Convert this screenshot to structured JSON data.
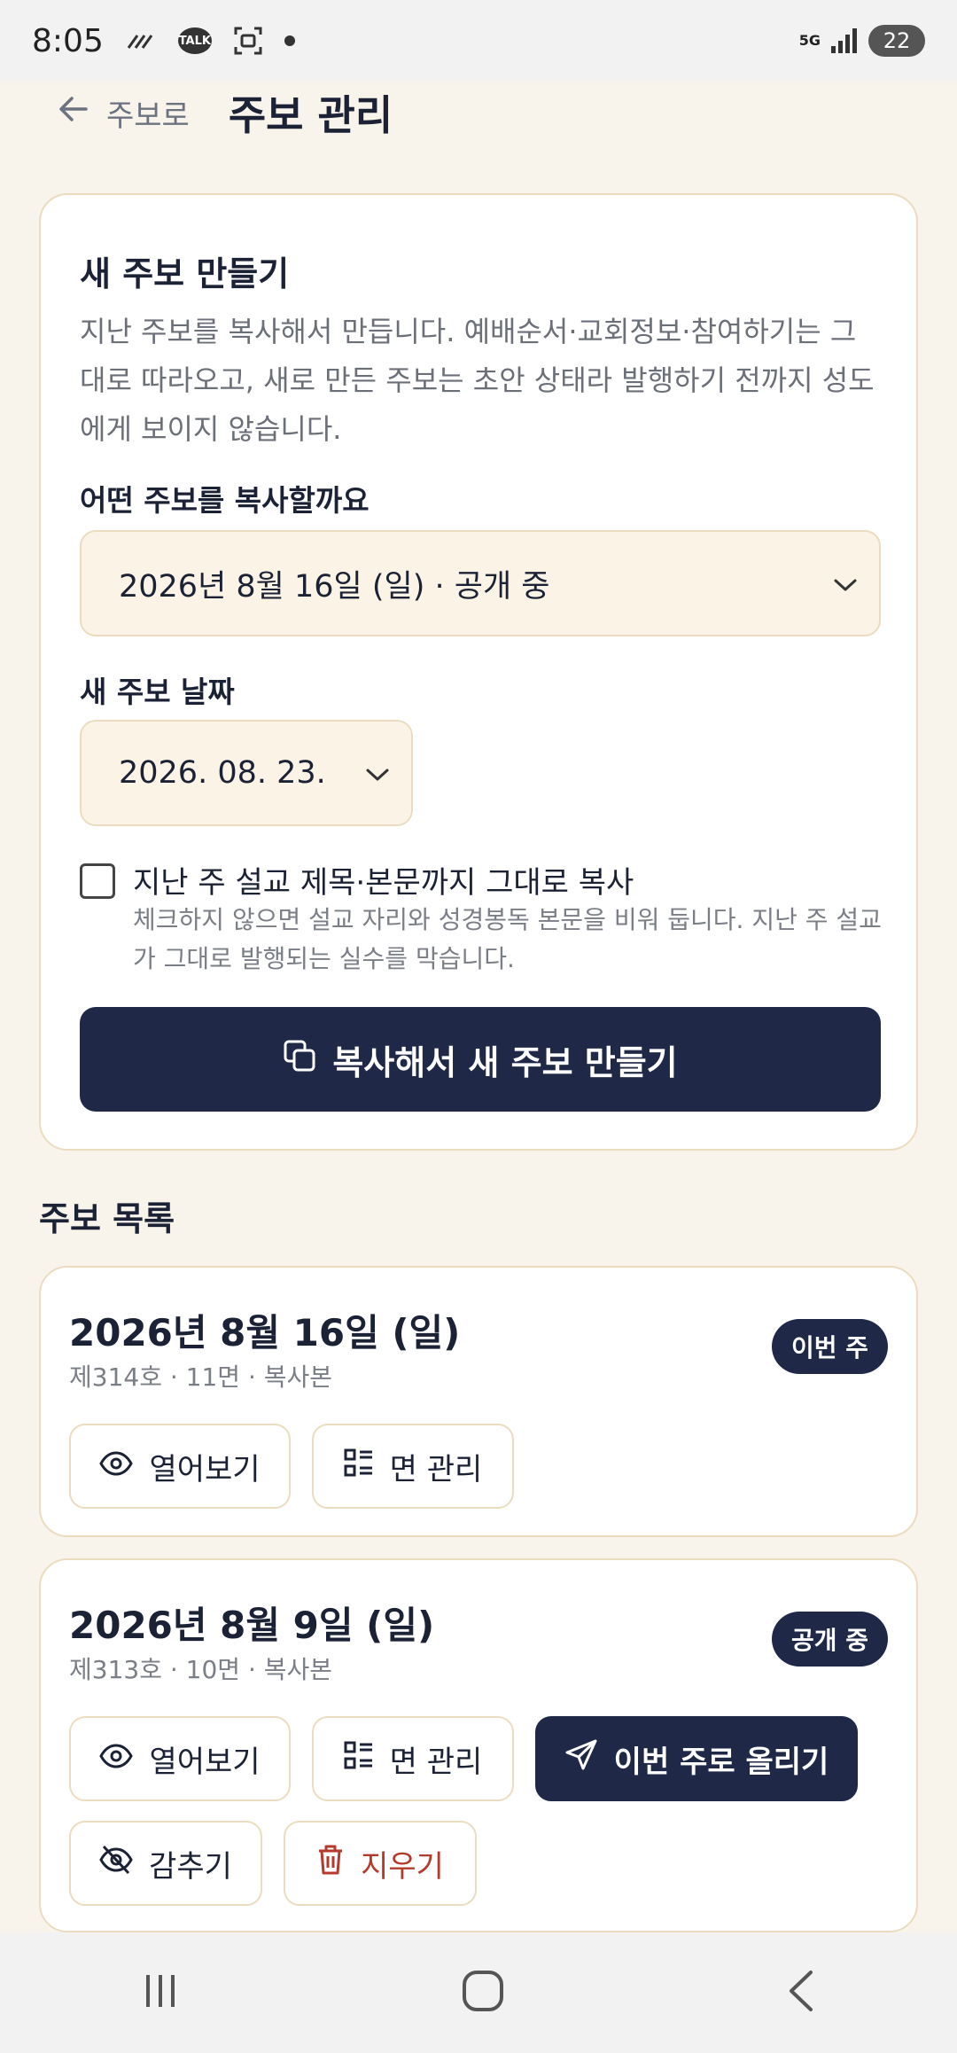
{
  "status_bar": {
    "time": "8:05",
    "talk_label": "TALK",
    "network": "5G",
    "battery": "22"
  },
  "header": {
    "back_label": "주보로",
    "title": "주보 관리"
  },
  "create": {
    "title": "새 주보 만들기",
    "description": "지난 주보를 복사해서 만듭니다. 예배순서·교회정보·참여하기는 그대로 따라오고, 새로 만든 주보는 초안 상태라 발행하기 전까지 성도에게 보이지 않습니다.",
    "source_label": "어떤 주보를 복사할까요",
    "source_value": "2026년 8월 16일 (일) · 공개 중",
    "date_label": "새 주보 날짜",
    "date_value": "2026. 08. 23.",
    "copy_sermon_label": "지난 주 설교 제목·본문까지 그대로 복사",
    "copy_sermon_help": "체크하지 않으면 설교 자리와 성경봉독 본문을 비워 둡니다. 지난 주 설교가 그대로 발행되는 실수를 막습니다.",
    "submit_label": "복사해서 새 주보 만들기"
  },
  "list": {
    "title": "주보 목록",
    "items": [
      {
        "date": "2026년 8월 16일 (일)",
        "meta": "제314호 · 11면 · 복사본",
        "badge": "이번 주",
        "view_label": "열어보기",
        "pages_label": "면 관리"
      },
      {
        "date": "2026년 8월 9일 (일)",
        "meta": "제313호 · 10면 · 복사본",
        "badge": "공개 중",
        "view_label": "열어보기",
        "pages_label": "면 관리",
        "publish_label": "이번 주로 올리기",
        "hide_label": "감추기",
        "delete_label": "지우기"
      }
    ]
  },
  "colors": {
    "background": "#f8f4ec",
    "navy": "#1f2847",
    "border": "#ecdcbf",
    "danger": "#b43a2c"
  }
}
